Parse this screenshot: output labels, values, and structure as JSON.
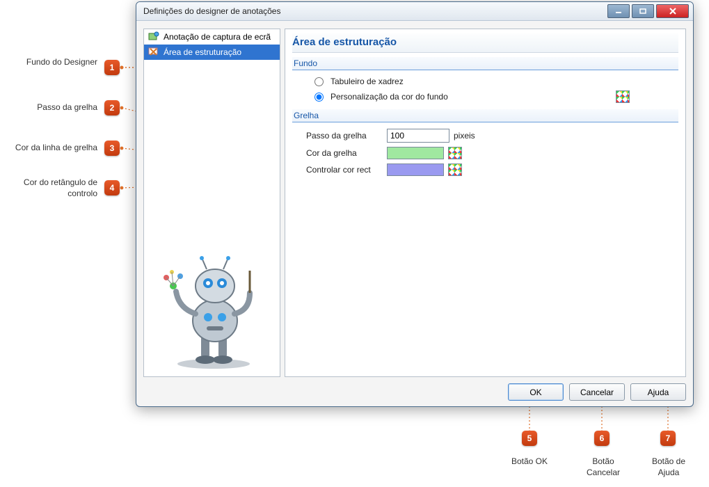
{
  "callouts": {
    "c1": {
      "num": "1",
      "label": "Fundo do Designer"
    },
    "c2": {
      "num": "2",
      "label": "Passo da grelha"
    },
    "c3": {
      "num": "3",
      "label": "Cor da linha de grelha"
    },
    "c4": {
      "num": "4",
      "label": "Cor do retângulo de controlo"
    },
    "c5": {
      "num": "5",
      "label": "Botão OK"
    },
    "c6": {
      "num": "6",
      "label": "Botão Cancelar"
    },
    "c7": {
      "num": "7",
      "label": "Botão de Ajuda"
    }
  },
  "window": {
    "title": "Definições do designer de anotações"
  },
  "nav": {
    "item1": "Anotação de captura de ecrã",
    "item2": "Área de estruturação"
  },
  "panel": {
    "title": "Área de estruturação",
    "section_fundo": "Fundo",
    "radio_chess": "Tabuleiro de xadrez",
    "radio_custom": "Personalização da cor do fundo",
    "section_grelha": "Grelha",
    "row_step_label": "Passo da grelha",
    "row_step_value": "100",
    "row_step_unit": "pixeis",
    "row_gridcolor_label": "Cor da grelha",
    "row_rectcolor_label": "Controlar cor rect",
    "grid_color": "#a0e8a0",
    "rect_color": "#9a9af0"
  },
  "buttons": {
    "ok": "OK",
    "cancel": "Cancelar",
    "help": "Ajuda"
  }
}
